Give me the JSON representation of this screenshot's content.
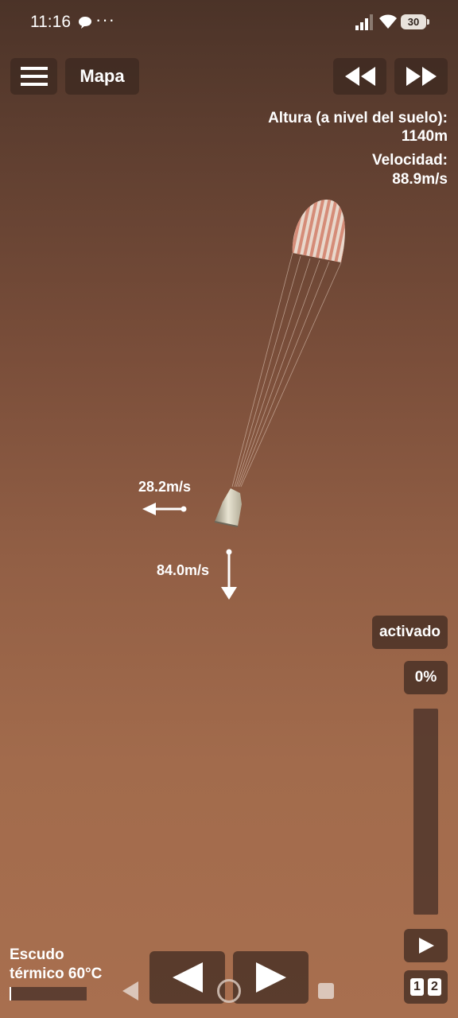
{
  "status_bar": {
    "time": "11:16",
    "extra": "···",
    "battery": "30"
  },
  "toolbar": {
    "menu_icon": "hamburger-menu-icon",
    "map_label": "Mapa",
    "rewind_icon": "rewind-icon",
    "fast_forward_icon": "fast-forward-icon"
  },
  "telemetry": {
    "altitude_label": "Altura (a nivel del suelo):",
    "altitude_value": "1140m",
    "velocity_label": "Velocidad:",
    "velocity_value": "88.9m/s"
  },
  "vectors": {
    "horizontal_speed": "28.2m/s",
    "vertical_speed": "84.0m/s"
  },
  "controls": {
    "activated_label": "activado",
    "throttle_percent": "0%",
    "throttle_level": 0,
    "play_icon": "play-icon",
    "stage_left": "1",
    "stage_right": "2"
  },
  "heat_shield": {
    "label_line1": "Escudo",
    "label_line2": "térmico 60°C",
    "level": 0.02
  },
  "colors": {
    "panel": "#3c2820",
    "sky_top": "#4b3328",
    "sky_bottom": "#a86f4f",
    "parachute_stripe": "#d58c78",
    "text": "#ffffff"
  }
}
